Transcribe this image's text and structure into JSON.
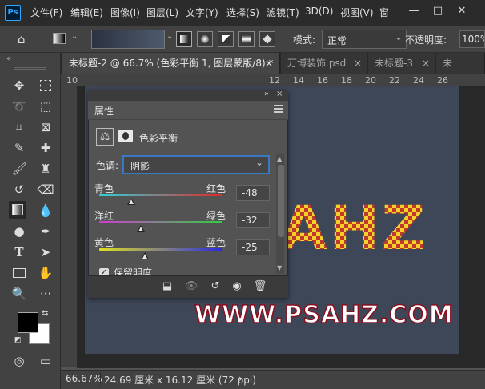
{
  "menubar": {
    "logo": "Ps",
    "items": [
      "文件(F)",
      "编辑(E)",
      "图像(I)",
      "图层(L)",
      "文字(Y)",
      "选择(S)",
      "滤镜(T)",
      "3D(D)",
      "视图(V)",
      "窗"
    ],
    "minimize": "—",
    "maximize": "□",
    "close": "✕"
  },
  "options": {
    "mode_label": "模式:",
    "mode_value": "正常",
    "opacity_label": "不透明度:",
    "opacity_value": "100%"
  },
  "tabs": [
    {
      "label": "未标题-2 @ 66.7% (色彩平衡 1, 图层蒙版/8) *",
      "close": "×"
    },
    {
      "label": "万博装饰.psd",
      "close": "×"
    },
    {
      "label": "未标题-3",
      "close": "×"
    },
    {
      "label": "未",
      "close": ""
    }
  ],
  "ruler": {
    "numbers": [
      "10",
      "12",
      "14",
      "16",
      "18",
      "20",
      "22",
      "24",
      "26"
    ]
  },
  "canvas": {
    "watermark": "WWW.PSAHZ.COM",
    "art_text": "AHZ"
  },
  "panel": {
    "title": "属性",
    "adj_title": "色彩平衡",
    "tone_label": "色调:",
    "tone_value": "阴影",
    "sliders": [
      {
        "left": "青色",
        "right": "红色",
        "value": "-48",
        "color_from": "#2fd0d8",
        "color_to": "#e02828",
        "pos": 0.26
      },
      {
        "left": "洋红",
        "right": "绿色",
        "value": "-32",
        "color_from": "#d23bd2",
        "color_to": "#2fd040",
        "pos": 0.34
      },
      {
        "left": "黄色",
        "right": "蓝色",
        "value": "-25",
        "color_from": "#e0e020",
        "color_to": "#2a2ae0",
        "pos": 0.375
      }
    ],
    "preserve_label": "保留明度"
  },
  "status": {
    "zoom": "66.67%",
    "doc_info": "24.69 厘米 x 16.12 厘米 (72 ppi)",
    "arrow": "›"
  },
  "colors": {
    "accent": "#31a8ff",
    "canvas_bg": "#3e4758",
    "watermark_fill": "#ffffff",
    "watermark_stroke": "#8a1020"
  }
}
